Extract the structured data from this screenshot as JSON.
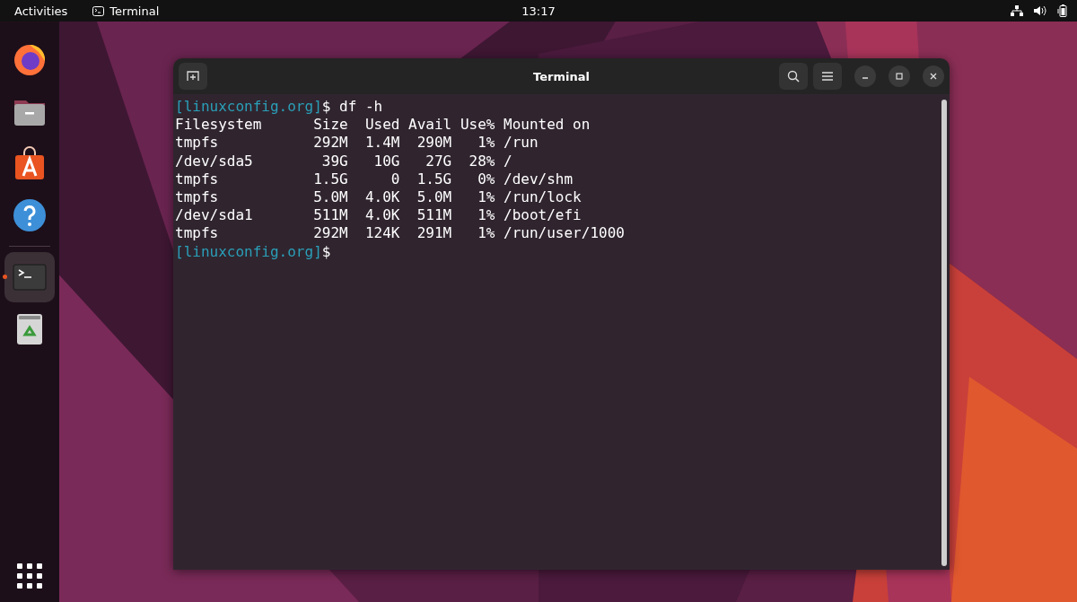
{
  "top_bar": {
    "activities": "Activities",
    "app_menu": "Terminal",
    "clock": "13:17"
  },
  "dock": {
    "apps": [
      {
        "kind": "firefox",
        "running": false
      },
      {
        "kind": "files",
        "running": false
      },
      {
        "kind": "software",
        "running": false
      },
      {
        "kind": "help",
        "running": false
      },
      {
        "kind": "terminal",
        "running": true
      },
      {
        "kind": "trash",
        "running": false
      }
    ]
  },
  "window": {
    "title": "Terminal",
    "lines": [
      {
        "kind": "prompt",
        "prompt": "[linuxconfig.org]",
        "text": "$ df -h"
      },
      {
        "kind": "output",
        "text": "Filesystem      Size  Used Avail Use% Mounted on"
      },
      {
        "kind": "output",
        "text": "tmpfs           292M  1.4M  290M   1% /run"
      },
      {
        "kind": "output",
        "text": "/dev/sda5        39G   10G   27G  28% /"
      },
      {
        "kind": "output",
        "text": "tmpfs           1.5G     0  1.5G   0% /dev/shm"
      },
      {
        "kind": "output",
        "text": "tmpfs           5.0M  4.0K  5.0M   1% /run/lock"
      },
      {
        "kind": "output",
        "text": "/dev/sda1       511M  4.0K  511M   1% /boot/efi"
      },
      {
        "kind": "output",
        "text": "tmpfs           292M  124K  291M   1% /run/user/1000"
      },
      {
        "kind": "prompt",
        "prompt": "[linuxconfig.org]",
        "text": "$"
      }
    ]
  }
}
